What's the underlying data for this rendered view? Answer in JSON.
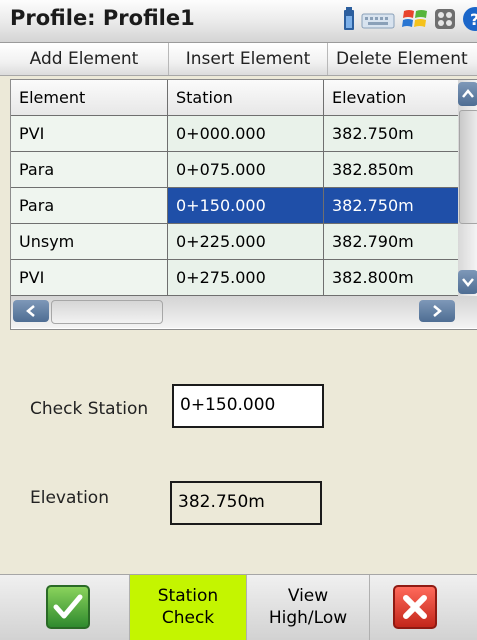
{
  "window": {
    "title": "Profile: Profile1"
  },
  "tray_icons": [
    "battery-icon",
    "keyboard-icon",
    "windows-flag-icon",
    "apps-icon",
    "help-icon"
  ],
  "toolbar": {
    "add_element": "Add Element",
    "insert_element": "Insert Element",
    "delete_element": "Delete Element"
  },
  "table": {
    "headers": [
      "Element",
      "Station",
      "Elevation"
    ],
    "rows": [
      [
        "PVI",
        "0+000.000",
        "382.750m"
      ],
      [
        "Para",
        "0+075.000",
        "382.850m"
      ],
      [
        "Para",
        "0+150.000",
        "382.750m"
      ],
      [
        "Unsym",
        "0+225.000",
        "382.790m"
      ],
      [
        "PVI",
        "0+275.000",
        "382.800m"
      ]
    ],
    "selected_row": 2
  },
  "form": {
    "check_station_label": "Check Station",
    "check_station_value": "0+150.000",
    "elevation_label": "Elevation",
    "elevation_value": "382.750m"
  },
  "bottom": {
    "station_check_line1": "Station",
    "station_check_line2": "Check",
    "view_line1": "View",
    "view_line2": "High/Low"
  },
  "colors": {
    "selection": "#1f4fa8",
    "active_button": "#c4f500",
    "row_background": "#e9f2ea"
  }
}
